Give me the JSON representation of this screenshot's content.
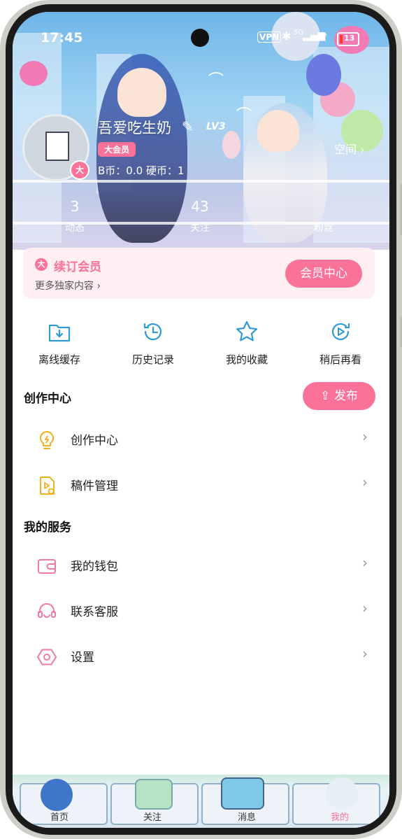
{
  "status_bar": {
    "time": "17:45",
    "vpn": "VPN",
    "network": "5G",
    "battery": "13"
  },
  "profile": {
    "username": "吾爱吃生奶",
    "level": "LV3",
    "vip_tag": "大会员",
    "avatar_badge": "大",
    "coins_text": "B币：0.0   硬币：1",
    "space_label": "空间",
    "stats": [
      {
        "value": "3",
        "label": "动态"
      },
      {
        "value": "43",
        "label": "关注"
      },
      {
        "value": "",
        "label": "粉丝"
      }
    ]
  },
  "vip_bar": {
    "icon_text": "大",
    "title": "续订会员",
    "subtitle": "更多独家内容",
    "button": "会员中心"
  },
  "quick_actions": [
    {
      "label": "离线缓存",
      "icon": "download-folder-icon"
    },
    {
      "label": "历史记录",
      "icon": "history-clock-icon"
    },
    {
      "label": "我的收藏",
      "icon": "star-icon"
    },
    {
      "label": "稍后再看",
      "icon": "watch-later-icon"
    }
  ],
  "creation": {
    "title": "创作中心",
    "publish_button": "发布",
    "items": [
      {
        "label": "创作中心",
        "icon": "lightbulb-icon"
      },
      {
        "label": "稿件管理",
        "icon": "video-file-icon"
      }
    ]
  },
  "services": {
    "title": "我的服务",
    "items": [
      {
        "label": "我的钱包",
        "icon": "wallet-icon"
      },
      {
        "label": "联系客服",
        "icon": "headset-icon"
      },
      {
        "label": "设置",
        "icon": "settings-hex-icon"
      }
    ]
  },
  "tab_bar": [
    {
      "label": "首页",
      "active": false
    },
    {
      "label": "关注",
      "active": false
    },
    {
      "label": "消息",
      "active": false
    },
    {
      "label": "我的",
      "active": true
    }
  ],
  "colors": {
    "accent": "#fb7299",
    "vip_bg": "#ffeef2",
    "icon_blue": "#2e9bd6",
    "icon_yellow": "#f2b01e",
    "icon_pink": "#f07aa0"
  }
}
